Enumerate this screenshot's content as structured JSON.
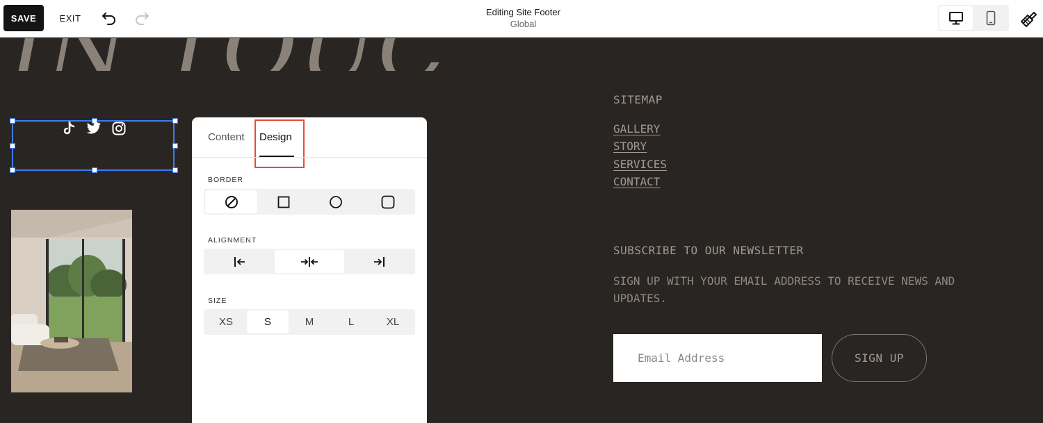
{
  "toolbar": {
    "save_label": "SAVE",
    "exit_label": "EXIT",
    "title": "Editing Site Footer",
    "subtitle": "Global",
    "icons": [
      "undo-icon",
      "redo-icon",
      "desktop-icon",
      "mobile-icon",
      "paintbrush-icon"
    ],
    "active_device": "desktop"
  },
  "page": {
    "heading": "IN TOUCH",
    "social_icons": [
      "tiktok-icon",
      "twitter-icon",
      "instagram-icon"
    ]
  },
  "panel": {
    "tabs": [
      {
        "label": "Content",
        "active": false
      },
      {
        "label": "Design",
        "active": true
      }
    ],
    "border": {
      "label": "BORDER",
      "options": [
        "none-icon",
        "square-icon",
        "circle-icon",
        "rounded-square-icon"
      ],
      "selected": 0
    },
    "alignment": {
      "label": "ALIGNMENT",
      "options": [
        "align-left-icon",
        "align-center-icon",
        "align-right-icon"
      ],
      "selected": 1
    },
    "size": {
      "label": "SIZE",
      "options": [
        "XS",
        "S",
        "M",
        "L",
        "XL"
      ],
      "selected": 1
    }
  },
  "footer": {
    "sitemap_title": "SITEMAP",
    "links": [
      "GALLERY",
      "STORY",
      "SERVICES",
      "CONTACT"
    ],
    "newsletter_title": "SUBSCRIBE TO OUR NEWSLETTER",
    "newsletter_desc": "SIGN UP WITH YOUR EMAIL ADDRESS TO RECEIVE NEWS AND UPDATES.",
    "email_placeholder": "Email Address",
    "signup_label": "SIGN UP"
  },
  "colors": {
    "background": "#292522",
    "selection": "#3e7cf4",
    "highlight": "#e84a3c",
    "footer_text": "#a39a93"
  }
}
